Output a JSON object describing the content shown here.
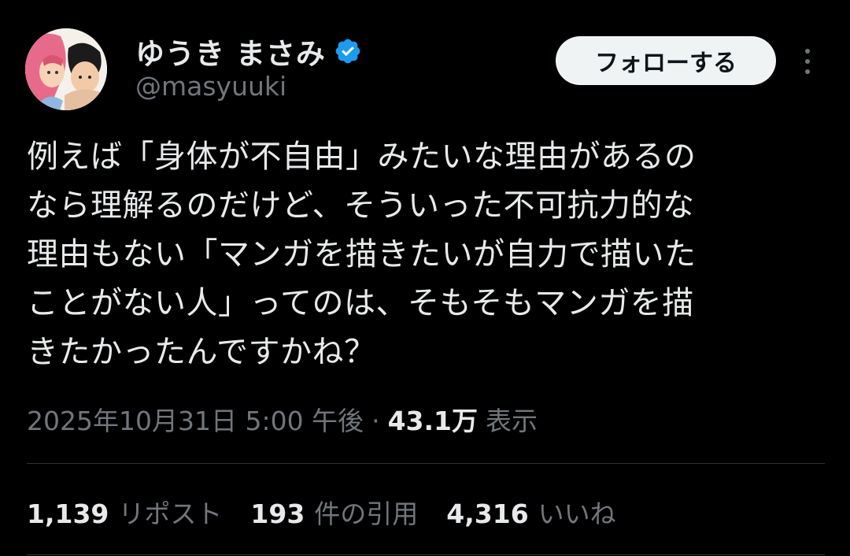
{
  "user": {
    "display_name": "ゆうき まさみ",
    "handle": "@masyuuki",
    "verified": true
  },
  "header": {
    "follow_label": "フォローする",
    "more_icon": "more-vertical-icon"
  },
  "tweet": {
    "text": "例えば「身体が不自由」みたいな理由があるの\nなら理解るのだけど、そういった不可抗力的な\n理由もない「マンガを描きたいが自力で描いた\nことがない人」ってのは、そもそもマンガを描\nきたかったんですかね？",
    "timestamp": "2025年10月31日 5:00 午後",
    "separator": "·",
    "views_count": "43.1万",
    "views_label": "表示"
  },
  "stats": {
    "reposts_count": "1,139",
    "reposts_label": "リポスト",
    "quotes_count": "193",
    "quotes_label": "件の引用",
    "likes_count": "4,316",
    "likes_label": "いいね"
  },
  "colors": {
    "background": "#000000",
    "text": "#e7e9ea",
    "muted": "#71767b",
    "verified_blue": "#1d9bf0",
    "button_bg": "#eff3f4"
  }
}
